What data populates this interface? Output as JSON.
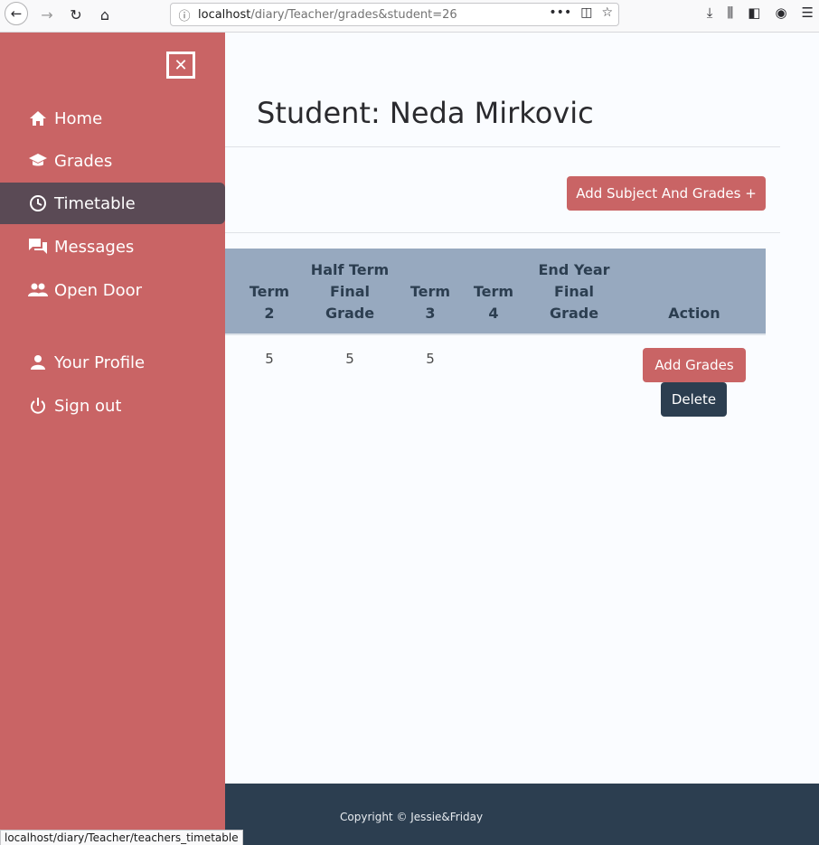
{
  "browser": {
    "url_host": "localhost",
    "url_path": "/diary/Teacher/grades&student=26",
    "status_url": "localhost/diary/Teacher/teachers_timetable"
  },
  "sidebar": {
    "items": [
      {
        "label": "Home",
        "icon": "home-icon"
      },
      {
        "label": "Grades",
        "icon": "graduation-cap-icon"
      },
      {
        "label": "Timetable",
        "icon": "clock-icon",
        "active": true
      },
      {
        "label": "Messages",
        "icon": "chat-icon"
      },
      {
        "label": "Open Door",
        "icon": "people-icon"
      },
      {
        "label": "Your Profile",
        "icon": "user-icon"
      },
      {
        "label": "Sign out",
        "icon": "power-icon"
      }
    ]
  },
  "main": {
    "title": "Student: Neda Mirkovic",
    "add_subject_label": "Add Subject And Grades +",
    "table": {
      "headers": {
        "term2": [
          "Term",
          "2"
        ],
        "half_term": [
          "Half Term",
          "Final",
          "Grade"
        ],
        "term3": [
          "Term",
          "3"
        ],
        "term4": [
          "Term",
          "4"
        ],
        "end_year": [
          "End Year",
          "Final",
          "Grade"
        ],
        "action": "Action"
      },
      "row": {
        "term2": "5",
        "half_term": "5",
        "term3": "5",
        "term4": "",
        "end_year": ""
      }
    },
    "add_grades_label": "Add Grades",
    "delete_label": "Delete"
  },
  "footer": {
    "copyright": "Copyright © Jessie&Friday"
  },
  "colors": {
    "sidebar": "#c96465",
    "active": "#5a4a55",
    "table_head": "#97a9bf",
    "footer": "#2c3e50"
  }
}
